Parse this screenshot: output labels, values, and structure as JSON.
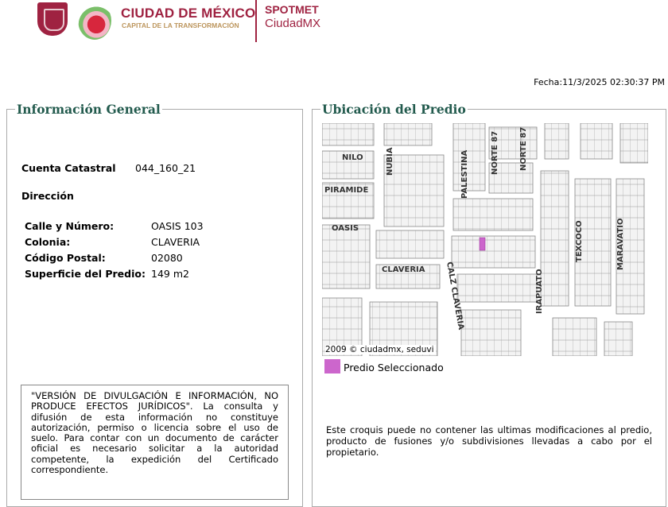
{
  "header": {
    "brand_title": "CIUDAD DE MÉXICO",
    "brand_subtitle": "CAPITAL DE LA TRANSFORMACIÓN",
    "app_name": "SPOTMET",
    "app_sub": "CiudadMX"
  },
  "fecha": "Fecha:11/3/2025 02:30:37 PM",
  "info": {
    "title": "Información General",
    "cuenta_label": "Cuenta Catastral",
    "cuenta_value": "044_160_21",
    "direccion_label": "Dirección",
    "fields": [
      {
        "label": "Calle y Número:",
        "value": "OASIS 103"
      },
      {
        "label": "Colonia:",
        "value": "CLAVERIA"
      },
      {
        "label": "Código Postal:",
        "value": "02080"
      },
      {
        "label": "Superficie del Predio:",
        "value": "149 m2"
      }
    ],
    "disclaimer": "\"VERSIÓN DE DIVULGACIÓN E INFORMACIÓN, NO PRODUCE EFECTOS JURÍDICOS\". La consulta y difusión de esta información no constituye autorización, permiso o licencia sobre el uso de suelo. Para contar con un documento de carácter oficial es necesario solicitar a la autoridad competente, la expedición del Certificado correspondiente."
  },
  "ubicacion": {
    "title": "Ubicación del Predio",
    "streets": [
      "NILO",
      "NUBIA",
      "PALESTINA",
      "NORTE 87",
      "NORTE 87",
      "PIRAMIDE",
      "OASIS",
      "CLAVERIA",
      "CALZ CLAVERIA",
      "IRAPUATO",
      "TEXCOCO",
      "MARAVATIO"
    ],
    "copyright": "2009 © ciudadmx, seduvi",
    "legend_label": "Predio Seleccionado",
    "highlight_color": "#cc66cc",
    "note": "Este croquis puede no contener las ultimas modificaciones al predio, producto de fusiones y/o subdivisiones llevadas a cabo por el propietario."
  }
}
